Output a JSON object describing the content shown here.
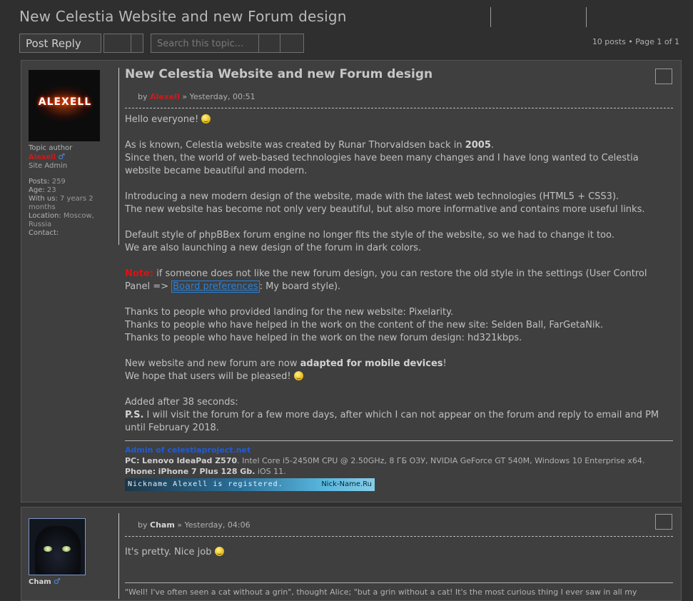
{
  "topic": {
    "title": "New Celestia Website and new Forum design",
    "pagination": "10 posts • Page 1 of 1"
  },
  "toolbar": {
    "post_reply_label": "Post Reply",
    "search_placeholder": "Search this topic..."
  },
  "post1": {
    "profile": {
      "avatar_text": "ALEXELL",
      "rank": "Topic author",
      "username": "Alexell",
      "group": "Site Admin",
      "posts_label": "Posts:",
      "posts": "259",
      "age_label": "Age:",
      "age": "23",
      "withus_label": "With us:",
      "withus": "7 years 2 months",
      "location_label": "Location:",
      "location": "Moscow, Russia",
      "contact_label": "Contact:"
    },
    "title": "New Celestia Website and new Forum design",
    "by": "by",
    "author": "Alexell",
    "time": "» Yesterday, 00:51",
    "p1": "Hello everyone!",
    "p2a": "As is known, Celestia website was created by Runar Thorvaldsen back in",
    "p2b": "2005",
    "p2c": ".",
    "p2d": "Since then, the world of web-based technologies have been many changes and I have long wanted to Celestia website became beautiful and modern.",
    "p3": "Introducing a new modern design of the website, made with the latest web technologies (HTML5 + CSS3).",
    "p3b": "The new website has become not only very beautiful, but also more informative and contains more useful links.",
    "p4": "Default style of phpBBex forum engine no longer fits the style of the website, so we had to change it too.",
    "p4b": "We are also launching a new design of the forum in dark colors.",
    "note_label": "Note:",
    "note_a": "if someone does not like the new forum design, you can restore the old style in the settings (User Control Panel =>",
    "note_link": "Board preferences",
    "note_b": ": My board style).",
    "thanks1": "Thanks to people who provided landing for the new website: Pixelarity.",
    "thanks2": "Thanks to people who have helped in the work on the content of the new site: Selden Ball, FarGetaNik.",
    "thanks3": "Thanks to people who have helped in the work on the new forum design: hd321kbps.",
    "mobile_a": "New website and new forum are now",
    "mobile_b": "adapted for mobile devices",
    "mobile_c": "!",
    "pleased": "We hope that users will be pleased!",
    "added": "Added after 38 seconds:",
    "ps_label": "P.S.",
    "ps_text": "I will visit the forum for a few more days, after which I can not appear on the forum and reply to email and PM until February 2018.",
    "sig": {
      "admin": "Admin of celestiaproject.net",
      "pc_label": "PC:",
      "pc_model": "Lenovo IdeaPad Z570",
      "pc_specs": ". Intel Core i5-2450M CPU @ 2.50GHz, 8 ГБ ОЗУ, NVIDIA GeForce GT 540M, Windows 10 Enterprise x64.",
      "phone_label": "Phone:",
      "phone_model": "iPhone 7 Plus 128 Gb.",
      "phone_os": " iOS 11.",
      "banner_left": "Nickname Alexell is registered.",
      "banner_right": "Nick-Name.Ru"
    }
  },
  "post2": {
    "profile": {
      "username": "Cham"
    },
    "by": "by",
    "author": "Cham",
    "time": "» Yesterday, 04:06",
    "text": "It's pretty. Nice job",
    "sig": "\"Well! I've often seen a cat without a grin\", thought Alice; \"but a grin without a cat! It's the most curious thing I ever saw in all my"
  }
}
